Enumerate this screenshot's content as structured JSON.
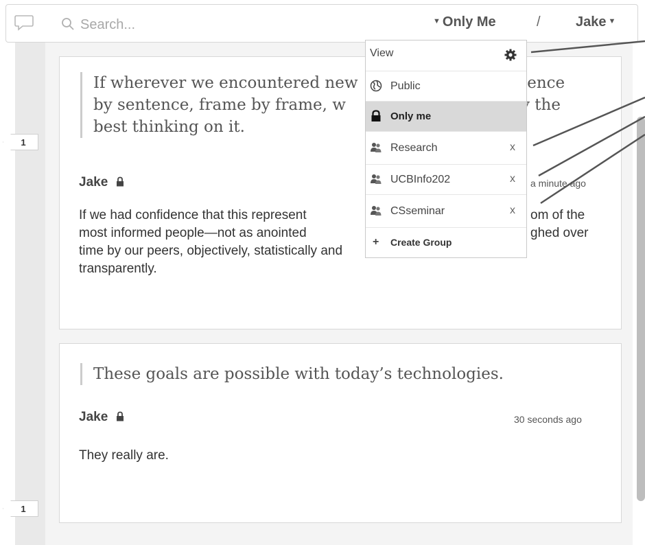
{
  "header": {
    "search_placeholder": "Search...",
    "scope_label": "Only Me",
    "separator": "/",
    "user_label": "Jake"
  },
  "dropdown": {
    "title": "View",
    "items": [
      {
        "label": "Public",
        "icon": "globe-icon"
      },
      {
        "label": "Only me",
        "icon": "lock-icon",
        "selected": true
      },
      {
        "label": "Research",
        "icon": "group-icon",
        "remove": "x"
      },
      {
        "label": "UCBInfo202",
        "icon": "group-icon",
        "remove": "x"
      },
      {
        "label": "CSseminar",
        "icon": "group-icon",
        "remove": "x"
      }
    ],
    "create_label": "Create Group",
    "create_prefix": "+"
  },
  "annotations": [
    {
      "count": "1",
      "quote_lines": [
        "If wherever we encountered new",
        "by sentence, frame by frame, w",
        "best thinking on it."
      ],
      "quote_right_lines": [
        "tence",
        "v the"
      ],
      "author": "Jake",
      "time": "a minute ago",
      "body_lines": [
        "If we had confidence that this represent",
        "most informed people—not as anointed",
        "time by our peers, objectively, statistically and transparently."
      ],
      "body_right_lines": [
        "om of the",
        "ghed over"
      ]
    },
    {
      "count": "1",
      "quote": "These goals are possible with today’s technologies.",
      "author": "Jake",
      "time": "30 seconds ago",
      "body": "They really are."
    }
  ],
  "colors": {
    "selected_row": "#d9d9d9",
    "pane_background": "#f4f4f4",
    "gutter": "#e9e9e9",
    "callout_line": "#555555"
  }
}
